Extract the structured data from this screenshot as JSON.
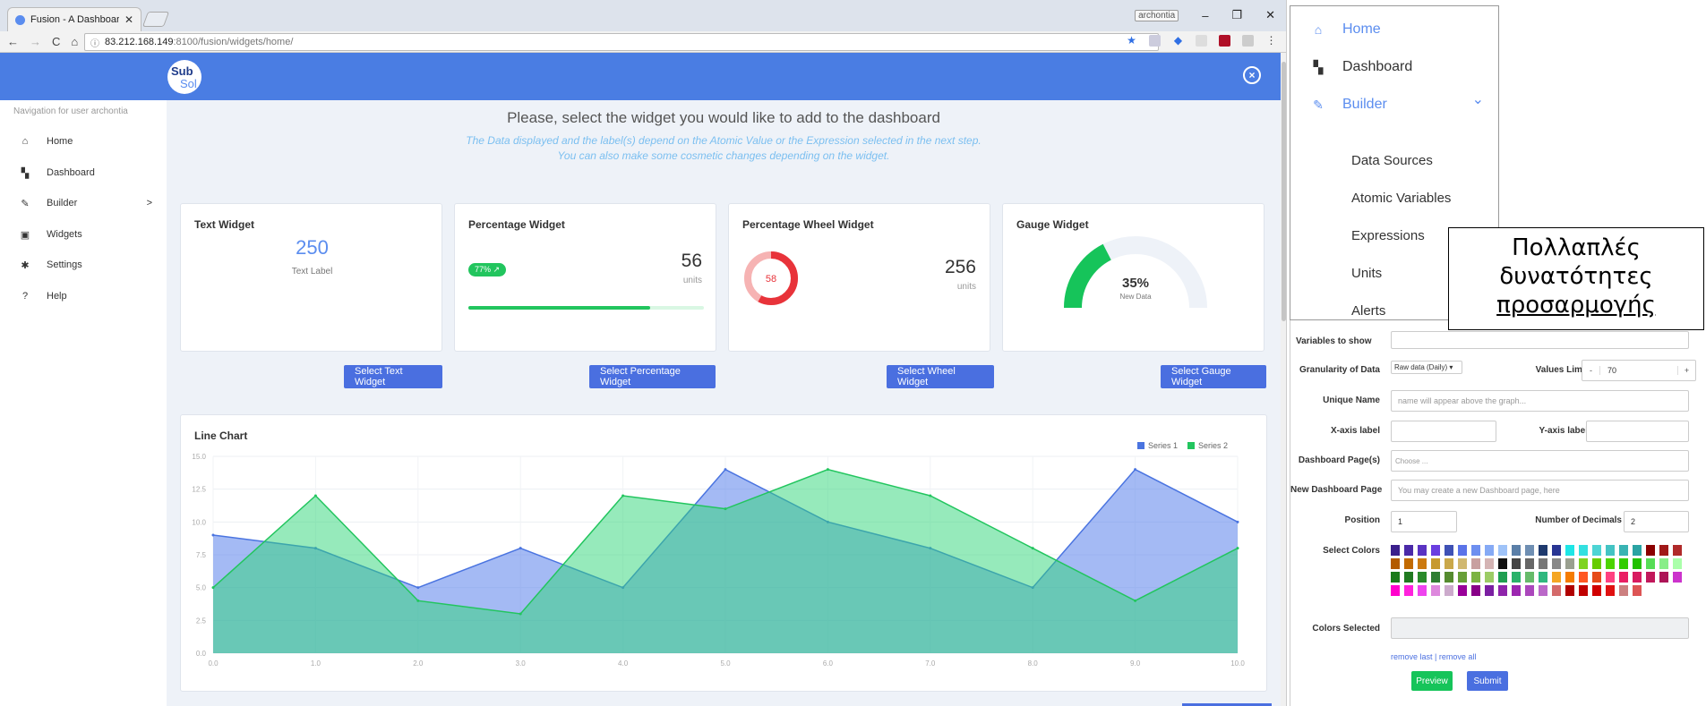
{
  "browser": {
    "tab_title": "Fusion - A Dashboard fo",
    "tab_close": "✕",
    "window_user": "archontia",
    "win_min": "–",
    "win_max": "❐",
    "win_close": "✕",
    "url_host": "83.212.168.149",
    "url_path": ":8100/fusion/widgets/home/"
  },
  "header": {
    "logo_top": "Sub",
    "logo_bottom": "Sol",
    "close_icon": "⊗"
  },
  "sidebar": {
    "caption": "Navigation for user archontia",
    "items": [
      {
        "label": "Home",
        "icon": "home-icon"
      },
      {
        "label": "Dashboard",
        "icon": "dashboard-icon"
      },
      {
        "label": "Builder",
        "icon": "wrench-icon",
        "arrow": ">"
      },
      {
        "label": "Widgets",
        "icon": "widgets-icon"
      },
      {
        "label": "Settings",
        "icon": "gear-icon"
      },
      {
        "label": "Help",
        "icon": "help-icon"
      }
    ]
  },
  "main": {
    "title": "Please, select the widget you would like to add to the dashboard",
    "subtitle_1": "The Data displayed and the label(s) depend on the Atomic Value or the Expression selected in the next step.",
    "subtitle_2": "You can also make some cosmetic changes depending on the widget.",
    "cards": {
      "text": {
        "title": "Text Widget",
        "value": "250",
        "label": "Text Label",
        "button": "Select Text Widget"
      },
      "percentage": {
        "title": "Percentage Widget",
        "badge": "77% ↗",
        "value": "56",
        "unit": "units",
        "progress": 0.77,
        "button": "Select Percentage Widget"
      },
      "wheel": {
        "title": "Percentage Wheel Widget",
        "wheel_value": "58",
        "wheel_fraction": 0.58,
        "value": "256",
        "unit": "units",
        "button": "Select Wheel Widget"
      },
      "gauge": {
        "title": "Gauge Widget",
        "value": "35%",
        "label": "New Data",
        "fraction": 0.35,
        "button": "Select Gauge Widget"
      }
    },
    "line_chart_title": "Line Chart"
  },
  "chart_data": {
    "type": "area",
    "title": "Line Chart",
    "x": [
      0,
      1,
      2,
      3,
      4,
      5,
      6,
      7,
      8,
      9,
      10
    ],
    "x_tick_labels": [
      "0.0",
      "1.0",
      "2.0",
      "3.0",
      "4.0",
      "5.0",
      "6.0",
      "7.0",
      "8.0",
      "9.0",
      "10.0"
    ],
    "y_tick_labels": [
      "0.0",
      "2.5",
      "5.0",
      "7.5",
      "10.0",
      "12.5",
      "15.0"
    ],
    "ylim": [
      0,
      15
    ],
    "grid": true,
    "legend": "top-right",
    "series": [
      {
        "name": "Series 1",
        "color": "#4a74e0",
        "values": [
          9,
          8,
          5,
          8,
          5,
          14,
          10,
          8,
          5,
          14,
          10
        ]
      },
      {
        "name": "Series 2",
        "color": "#22c55e",
        "values": [
          5,
          12,
          4,
          3,
          12,
          11,
          14,
          12,
          8,
          4,
          8
        ]
      }
    ]
  },
  "menu_overlay": {
    "items": [
      {
        "label": "Home",
        "icon": "home-icon"
      },
      {
        "label": "Dashboard",
        "icon": "dashboard-icon"
      },
      {
        "label": "Builder",
        "icon": "wrench-icon",
        "arrow": "⌄"
      }
    ],
    "sub_items": [
      "Data Sources",
      "Atomic Variables",
      "Expressions",
      "Units",
      "Alerts"
    ]
  },
  "form": {
    "variables_to_show": "Variables to show",
    "granularity_label": "Granularity of Data",
    "granularity_value": "Raw data (Daily) ▾",
    "values_limit_label": "Values Limit",
    "values_limit_minus": "-",
    "values_limit_value": "70",
    "values_limit_plus": "+",
    "unique_name_label": "Unique Name",
    "unique_name_placeholder": "name will appear above the graph...",
    "x_axis_label": "X-axis label",
    "y_axis_label": "Y-axis label",
    "dashboard_pages_label": "Dashboard Page(s)",
    "dashboard_pages_placeholder": "Choose ...",
    "new_page_label": "New Dashboard Page",
    "new_page_placeholder": "You may create a new Dashboard page, here",
    "position_label": "Position",
    "position_value": "1",
    "decimals_label": "Number of Decimals",
    "decimals_value": "2",
    "select_colors_label": "Select Colors",
    "colors_selected_label": "Colors Selected",
    "remove_links": "remove last | remove all",
    "preview_button": "Preview",
    "submit_button": "Submit",
    "palette": [
      [
        "#3b1f8c",
        "#4b2aa8",
        "#5a33c2",
        "#6a3ee0",
        "#3f51b5",
        "#5b73e8",
        "#6d8ff0",
        "#86aaf5",
        "#9fc3f8",
        "#5b7fa8",
        "#6f8fb3",
        "#1f3a6e",
        "#283593",
        "#1ee6e6",
        "#33e0e0",
        "#4dd4d4",
        "#44c4c4",
        "#39b3b3",
        "#2aa3a3",
        "#8b0000",
        "#a01818",
        "#b02a2a"
      ],
      [
        "#b35a00",
        "#c26a00",
        "#cc7a10",
        "#c79a30",
        "#caa84a",
        "#d0b870",
        "#c8a0a0",
        "#d4b4b4",
        "#111111",
        "#444444",
        "#666666",
        "#777777",
        "#888888",
        "#9aa090",
        "#7ed321",
        "#66cc00",
        "#4cd400",
        "#33cc00",
        "#22c000",
        "#55dd55",
        "#88ee88",
        "#aaffaa"
      ],
      [
        "#1b7a1b",
        "#217a21",
        "#2a8a2a",
        "#2e7d32",
        "#558b2f",
        "#689f38",
        "#7cb342",
        "#9ccc65",
        "#1f9e50",
        "#2ab26a",
        "#66bb6a",
        "#2fb87f",
        "#f5a623",
        "#f57c00",
        "#ff5722",
        "#e64a19",
        "#ff4081",
        "#e91e63",
        "#d81b60",
        "#c2185b",
        "#ad1457",
        "#cc33cc"
      ],
      [
        "#ff00cc",
        "#ff22dd",
        "#ee44ee",
        "#dd88dd",
        "#ccaacc",
        "#990099",
        "#880088",
        "#7b1fa2",
        "#8e24aa",
        "#9c27b0",
        "#ab47bc",
        "#ba68c8",
        "#d46a6a",
        "#b00000",
        "#c00000",
        "#d00000",
        "#e01010",
        "#cc8080",
        "#dd5555"
      ]
    ]
  },
  "callout": {
    "line1": "Πολλαπλές",
    "line2": "δυνατότητες",
    "line3": "προσαρμογής"
  }
}
